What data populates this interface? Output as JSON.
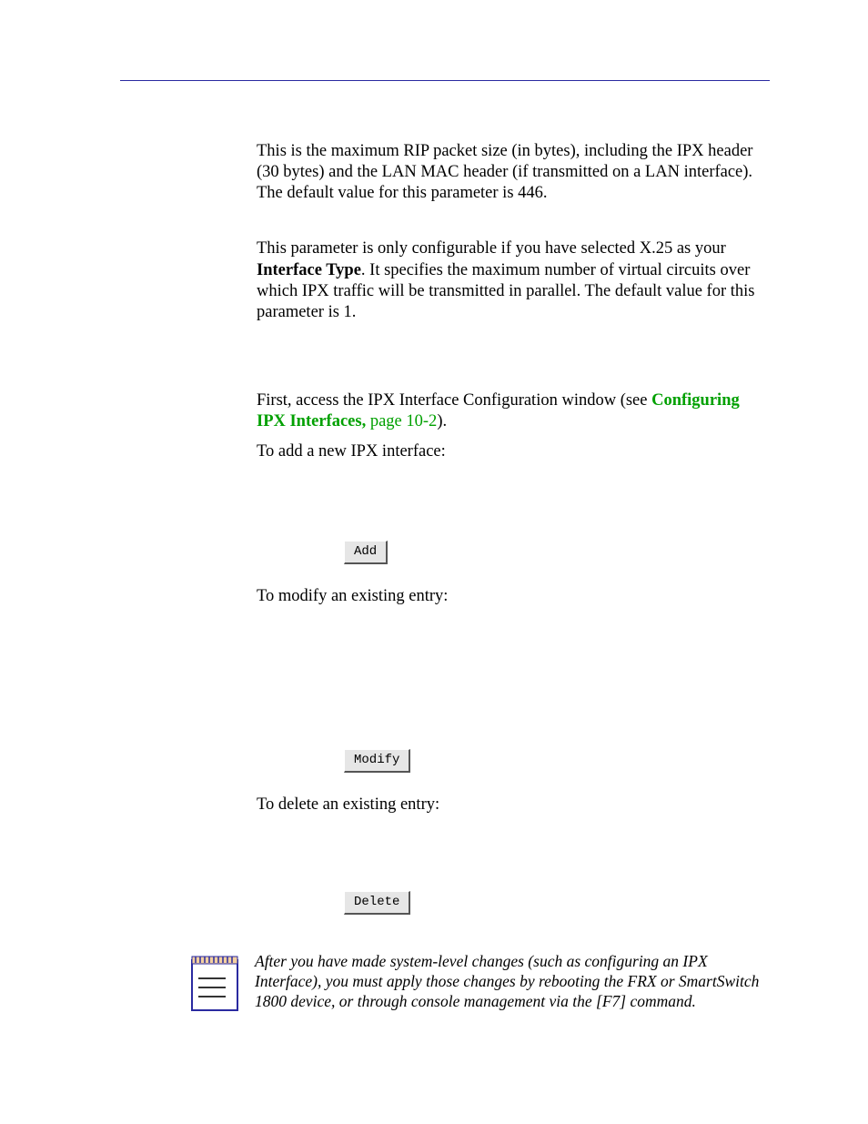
{
  "paragraphs": {
    "rip_size": {
      "text_before_bold": "This is the maximum RIP packet size (in bytes), including the IPX header (30 bytes) and the LAN MAC header (if transmitted on a LAN interface). The default value for this parameter is 446.",
      "bold": "",
      "text_after_bold": ""
    },
    "x25": {
      "text_before_bold": "This parameter is only configurable if you have selected X.25 as your ",
      "bold": "Interface Type",
      "text_after_bold": ". It specifies the maximum number of virtual circuits over which IPX traffic will be transmitted in parallel. The default value for this parameter is 1."
    },
    "access": {
      "prefix": "First, access the IPX Interface Configuration window (see ",
      "link_bold": "Configuring IPX Interfaces,",
      "link_plain": " page 10-2",
      "suffix": ")."
    },
    "add_intro": "To add a new IPX interface:",
    "modify_intro": "To modify an existing entry:",
    "delete_intro": "To delete an existing entry:"
  },
  "buttons": {
    "add": "Add",
    "modify": "Modify",
    "delete": "Delete"
  },
  "note": {
    "text": "After you have made system-level changes (such as configuring an IPX Interface), you must apply those changes by rebooting the FRX or SmartSwitch 1800 device, or through console management via the [F7] command."
  }
}
